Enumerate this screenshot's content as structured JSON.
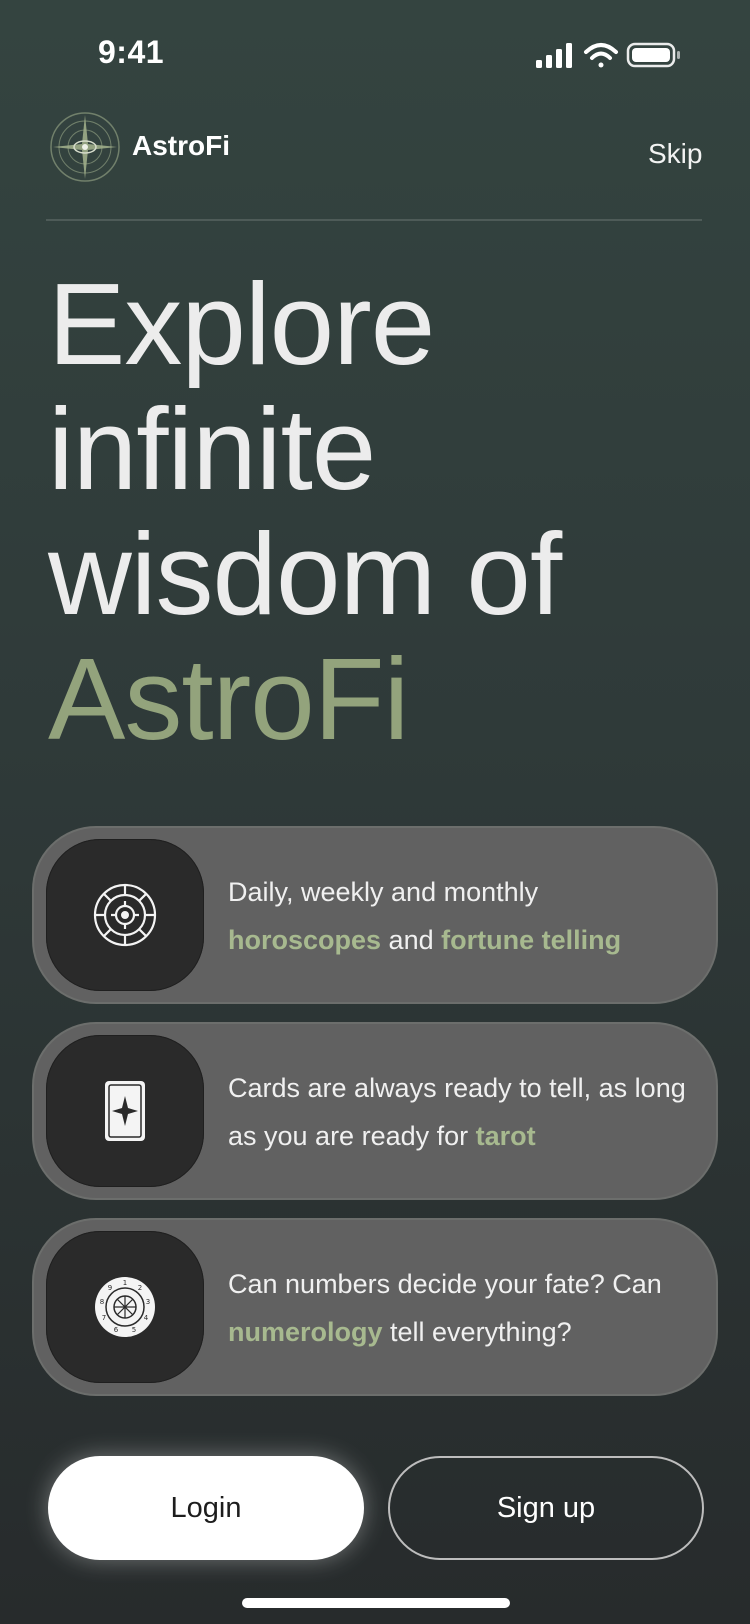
{
  "status_bar": {
    "time": "9:41",
    "icons": [
      "cellular-signal-icon",
      "wifi-icon",
      "battery-icon"
    ]
  },
  "header": {
    "brand": "AstroFi",
    "skip_label": "Skip",
    "logo_icon": "astro-compass-logo-icon"
  },
  "hero": {
    "line1": "Explore",
    "line2": "infinite",
    "line3": "wisdom of",
    "line4_accent": "AstroFi"
  },
  "features": [
    {
      "icon": "zodiac-wheel-icon",
      "t1": "Daily, weekly and monthly ",
      "hl1": "horoscopes",
      "t2": " and ",
      "hl2": "fortune telling",
      "t3": ""
    },
    {
      "icon": "tarot-card-icon",
      "t1": "Cards are always ready to tell, as long as you are ready for ",
      "hl1": "tarot",
      "t2": ""
    },
    {
      "icon": "numerology-wheel-icon",
      "t1": "Can numbers decide your fate? Can ",
      "hl1": "numerology",
      "t2": " tell everything?"
    }
  ],
  "actions": {
    "login": "Login",
    "signup": "Sign up"
  },
  "colors": {
    "accent": "#93a37c",
    "highlight": "#a7b98f",
    "card": "#616161",
    "icon_box": "#2a2a2a"
  }
}
